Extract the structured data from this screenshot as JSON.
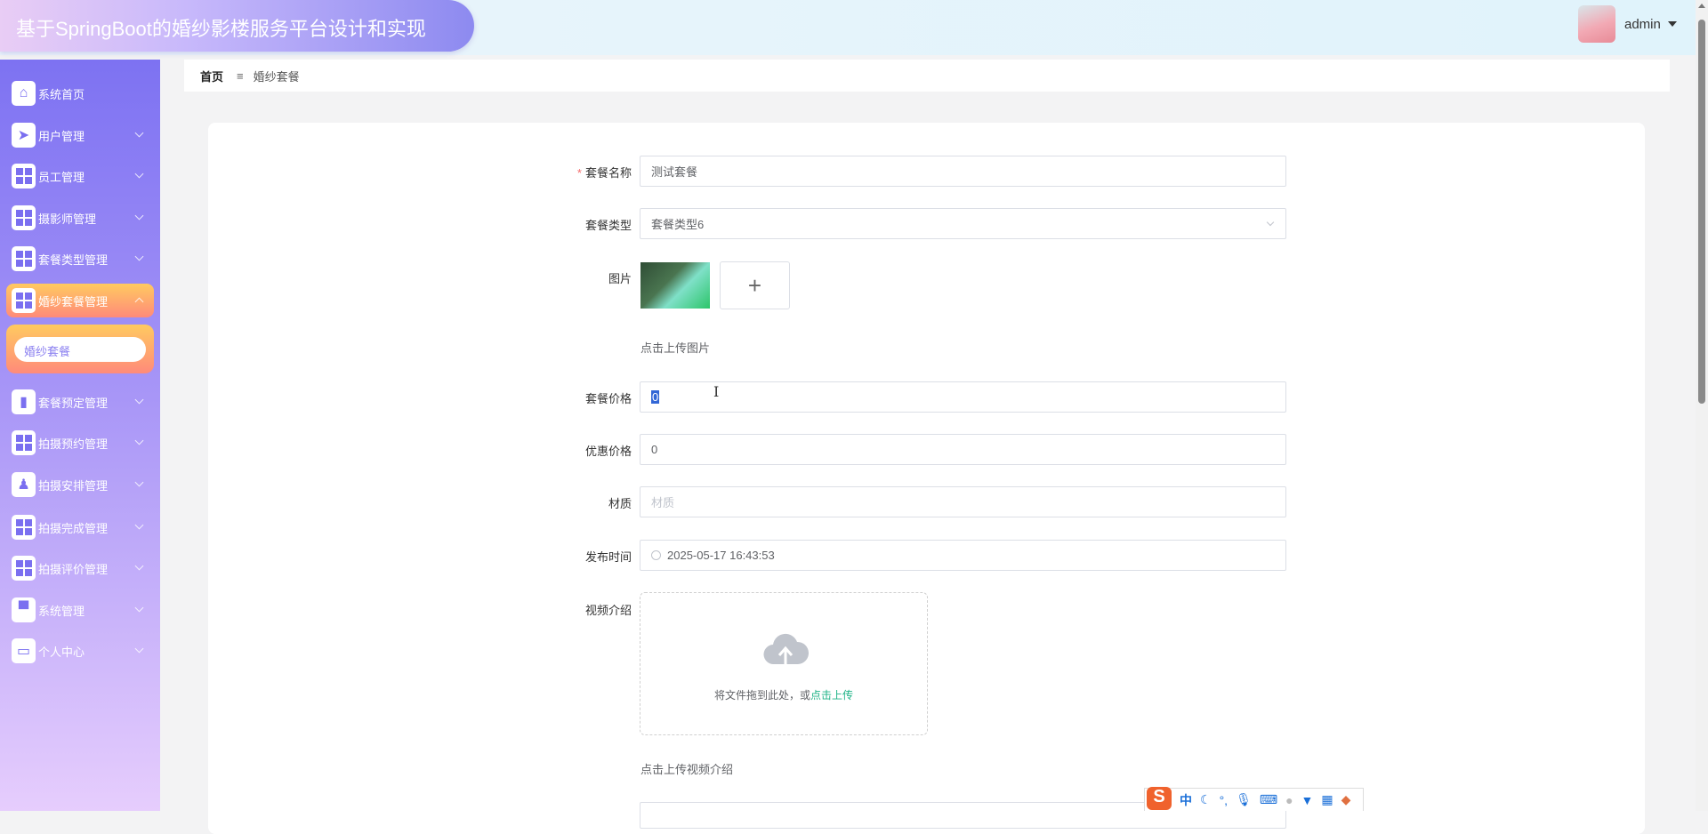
{
  "header": {
    "title": "基于SpringBoot的婚纱影楼服务平台设计和实现",
    "username": "admin"
  },
  "sidebar": {
    "items": [
      {
        "label": "系统首页",
        "icon": "home-icon"
      },
      {
        "label": "用户管理",
        "icon": "send-icon"
      },
      {
        "label": "员工管理",
        "icon": "grid-icon"
      },
      {
        "label": "摄影师管理",
        "icon": "grid-icon"
      },
      {
        "label": "套餐类型管理",
        "icon": "grid-icon"
      },
      {
        "label": "婚纱套餐管理",
        "icon": "grid-icon"
      },
      {
        "label": "套餐预定管理",
        "icon": "ticket-icon"
      },
      {
        "label": "拍摄预约管理",
        "icon": "grid-icon"
      },
      {
        "label": "拍摄安排管理",
        "icon": "stamp-icon"
      },
      {
        "label": "拍摄完成管理",
        "icon": "grid-icon"
      },
      {
        "label": "拍摄评价管理",
        "icon": "grid-icon"
      },
      {
        "label": "系统管理",
        "icon": "monitor-icon"
      },
      {
        "label": "个人中心",
        "icon": "wallet-icon"
      }
    ],
    "submenu": {
      "label": "婚纱套餐"
    }
  },
  "breadcrumb": {
    "home": "首页",
    "separator": "≡",
    "current": "婚纱套餐"
  },
  "form": {
    "name": {
      "label": "套餐名称",
      "required": "*",
      "value": "测试套餐"
    },
    "type": {
      "label": "套餐类型",
      "value": "套餐类型6"
    },
    "image": {
      "label": "图片",
      "hint": "点击上传图片",
      "add": "+"
    },
    "price": {
      "label": "套餐价格",
      "value": "0"
    },
    "discount": {
      "label": "优惠价格",
      "value": "0"
    },
    "material": {
      "label": "材质",
      "placeholder": "材质"
    },
    "publish_time": {
      "label": "发布时间",
      "value": "2025-05-17 16:43:53"
    },
    "video": {
      "label": "视频介绍",
      "drop_text": "将文件拖到此处，或",
      "drop_link": "点击上传",
      "hint": "点击上传视频介绍"
    }
  },
  "ime": {
    "logo": "S",
    "mode": "中",
    "punct": "°,"
  },
  "colors": {
    "accent": "#7d72f2",
    "active": "#ff9a70",
    "link": "#1fb387"
  }
}
